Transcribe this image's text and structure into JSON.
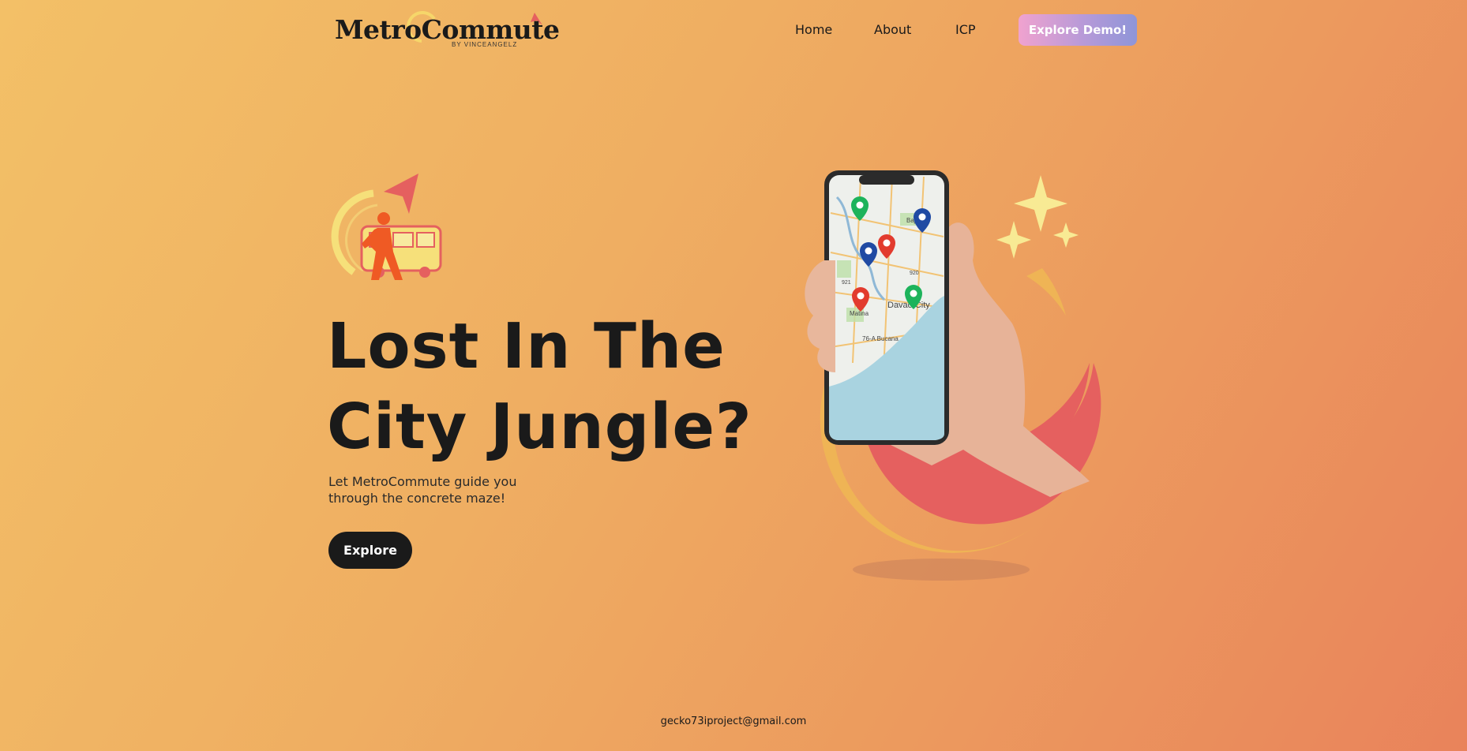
{
  "brand": {
    "name": "MetroCommute",
    "tagline": "BY VINCEANGELZ"
  },
  "nav": {
    "links": [
      {
        "label": "Home"
      },
      {
        "label": "About"
      },
      {
        "label": "ICP"
      }
    ],
    "cta_label": "Explore Demo!"
  },
  "hero": {
    "headline_line1": "Lost In The",
    "headline_line2": "City Jungle?",
    "subtitle_line1": "Let MetroCommute guide you",
    "subtitle_line2": "through the concrete maze!",
    "button_label": "Explore",
    "map_labels": [
      "Bajada",
      "Davao City",
      "Matina",
      "76-A Bucana",
      "921",
      "920"
    ]
  },
  "footer": {
    "email": "gecko73iproject@gmail.com"
  },
  "colors": {
    "bg_start": "#f3c067",
    "bg_end": "#e9835b",
    "accent_red": "#e5605f",
    "accent_yellow": "#f6e27a",
    "dark": "#1a1a1a"
  }
}
